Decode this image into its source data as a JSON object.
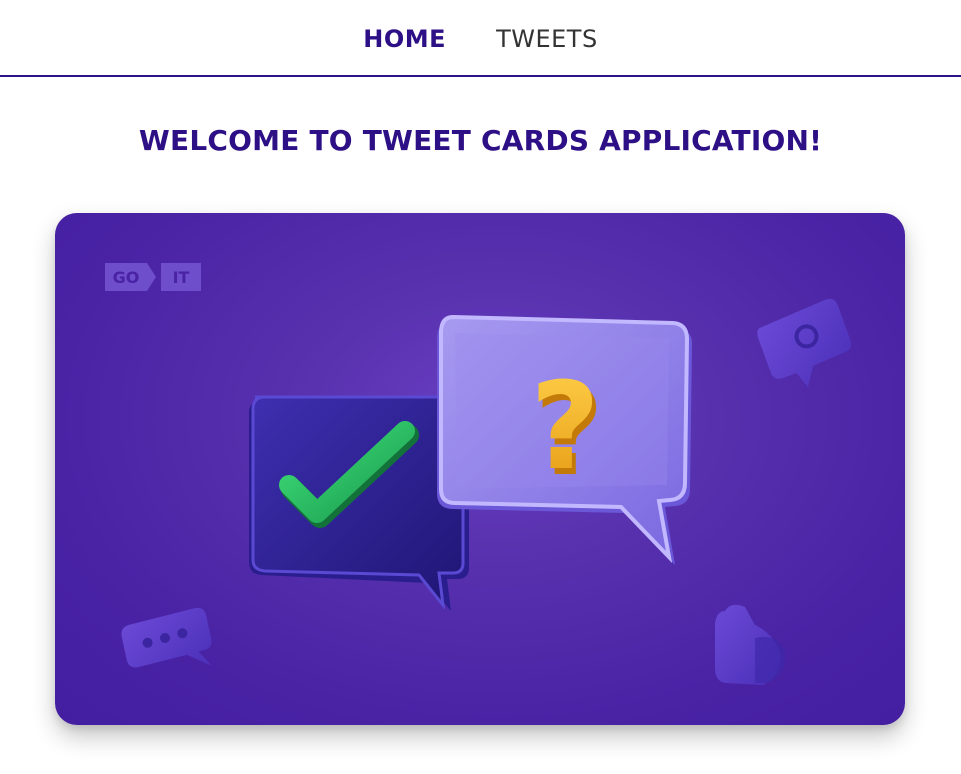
{
  "nav": {
    "items": [
      {
        "label": "HOME",
        "active": true
      },
      {
        "label": "TWEETS",
        "active": false
      }
    ]
  },
  "page": {
    "title": "WELCOME TO TWEET CARDS APPLICATION!"
  },
  "hero": {
    "logo": {
      "left": "GO",
      "right": "IT"
    },
    "icons": [
      "checkmark-bubble-icon",
      "question-bubble-icon",
      "chat-dots-icon",
      "heart-icon",
      "comment-icon"
    ]
  },
  "colors": {
    "brand": "#2d0f86",
    "hero_bg": "#4a23a5",
    "check": "#2bc062",
    "question": "#f5b82e"
  }
}
